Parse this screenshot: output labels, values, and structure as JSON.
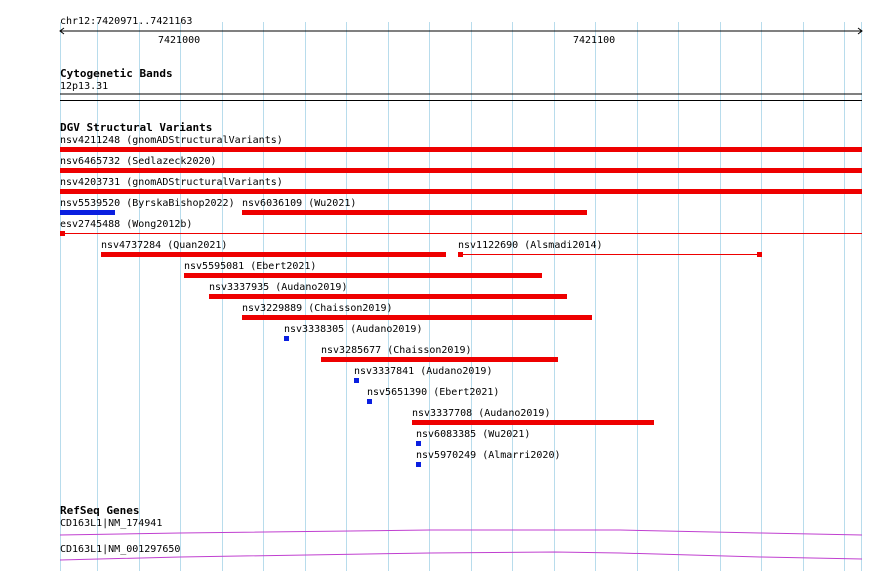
{
  "ruler": {
    "position": "chr12:7420971..7421163",
    "ticks": [
      "7421000",
      "7421100"
    ]
  },
  "cytoband": {
    "title": "Cytogenetic Bands",
    "band": "12p13.31"
  },
  "dgv": {
    "title": "DGV Structural Variants",
    "variants": [
      "nsv4211248 (gnomADStructuralVariants)",
      "nsv6465732 (Sedlazeck2020)",
      "nsv4203731 (gnomADStructuralVariants)",
      "nsv5539520 (ByrskaBishop2022)",
      "nsv6036109 (Wu2021)",
      "esv2745488 (Wong2012b)",
      "nsv4737284 (Quan2021)",
      "nsv1122690 (Alsmadi2014)",
      "nsv5595081 (Ebert2021)",
      "nsv3337935 (Audano2019)",
      "nsv3229889 (Chaisson2019)",
      "nsv3338305 (Audano2019)",
      "nsv3285677 (Chaisson2019)",
      "nsv3337841 (Audano2019)",
      "nsv5651390 (Ebert2021)",
      "nsv3337708 (Audano2019)",
      "nsv6083385 (Wu2021)",
      "nsv5970249 (Almarri2020)"
    ]
  },
  "refseq": {
    "title": "RefSeq Genes",
    "genes": [
      "CD163L1|NM_174941",
      "CD163L1|NM_001297650"
    ]
  },
  "colors": {
    "loss": "#ee0000",
    "gain": "#0a1fe0",
    "gene": "#c040d0",
    "grid": "#b8dcec"
  }
}
